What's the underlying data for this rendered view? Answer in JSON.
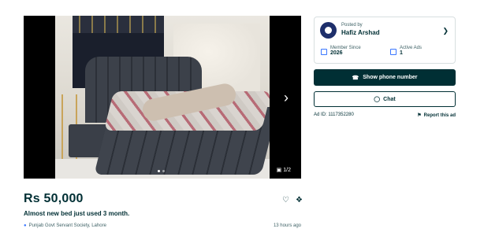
{
  "listing": {
    "price": "Rs 50,000",
    "title": "Almost new bed just used 3 month.",
    "location": "Punjab Govt Servant Society, Lahore",
    "posted_time": "13 hours ago"
  },
  "gallery": {
    "image_count": "1/2",
    "next_icon": "chevron-right-icon",
    "camera_icon": "camera-icon"
  },
  "seller": {
    "posted_by_label": "Posted by",
    "name": "Hafiz Arshad",
    "member_since_label": "Member Since",
    "member_since_value": "2026",
    "active_ads_label": "Active Ads",
    "active_ads_value": "1"
  },
  "buttons": {
    "show_phone": "Show phone number",
    "chat": "Chat"
  },
  "ad": {
    "id_text": "Ad ID: 1117352280",
    "report": "Report this ad"
  },
  "colors": {
    "primary": "#002f34",
    "accent": "#3a77ff"
  }
}
